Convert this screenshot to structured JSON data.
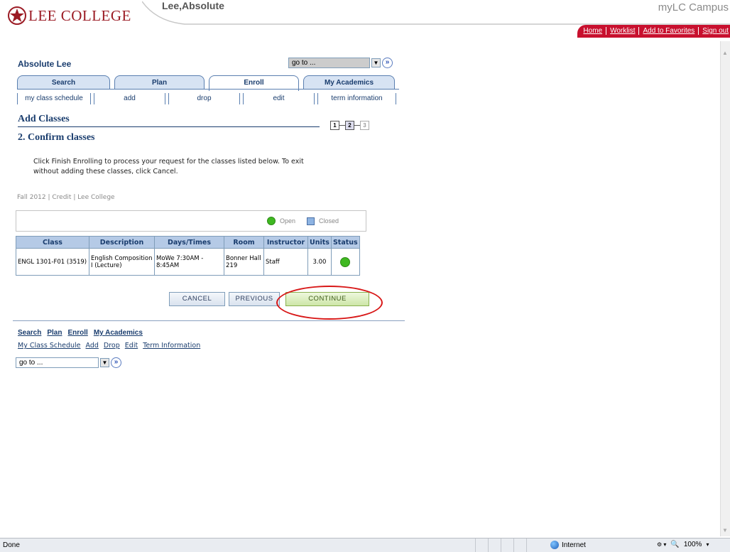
{
  "header": {
    "logo_text": "LEE COLLEGE",
    "user_name": "Lee,Absolute",
    "campus": "myLC Campus",
    "links": [
      "Home",
      "Worklist",
      "Add to Favorites",
      "Sign out"
    ]
  },
  "person": "Absolute Lee",
  "goto": {
    "label": "go to ...",
    "go_symbol": "»"
  },
  "tabs": [
    {
      "label": "Search",
      "active": false
    },
    {
      "label": "Plan",
      "active": false
    },
    {
      "label": "Enroll",
      "active": true
    },
    {
      "label": "My Academics",
      "active": false
    }
  ],
  "subtabs": [
    "my class schedule",
    "add",
    "drop",
    "edit",
    "term information"
  ],
  "page": {
    "title": "Add Classes",
    "steps": [
      "1",
      "2",
      "3"
    ],
    "current_step": 2,
    "subtitle": "2.  Confirm classes",
    "instructions": "Click Finish Enrolling to process your request for the classes listed below. To exit without adding these classes, click Cancel.",
    "term": "Fall 2012 | Credit | Lee College"
  },
  "legend": {
    "open": "Open",
    "closed": "Closed"
  },
  "table": {
    "headers": [
      "Class",
      "Description",
      "Days/Times",
      "Room",
      "Instructor",
      "Units",
      "Status"
    ],
    "rows": [
      {
        "class": "ENGL 1301-F01 (3519)",
        "description": "English Composition I (Lecture)",
        "days_times": "MoWe 7:30AM - 8:45AM",
        "room": "Bonner Hall 219",
        "instructor": "Staff",
        "units": "3.00",
        "status": "Open"
      }
    ]
  },
  "buttons": {
    "cancel": "CANCEL",
    "previous": "PREVIOUS",
    "continue": "CONTINUE"
  },
  "bottom_nav": {
    "main": [
      "Search",
      "Plan",
      "Enroll",
      "My Academics"
    ],
    "sub": [
      "My Class Schedule",
      "Add",
      "Drop",
      "Edit",
      "Term Information"
    ]
  },
  "statusbar": {
    "left": "Done",
    "zone": "Internet",
    "zoom": "100%"
  },
  "colors": {
    "brand_red": "#c8102e",
    "nav_blue": "#1a3d6e",
    "open_green": "#3fb821",
    "highlight_red": "#d81717"
  }
}
